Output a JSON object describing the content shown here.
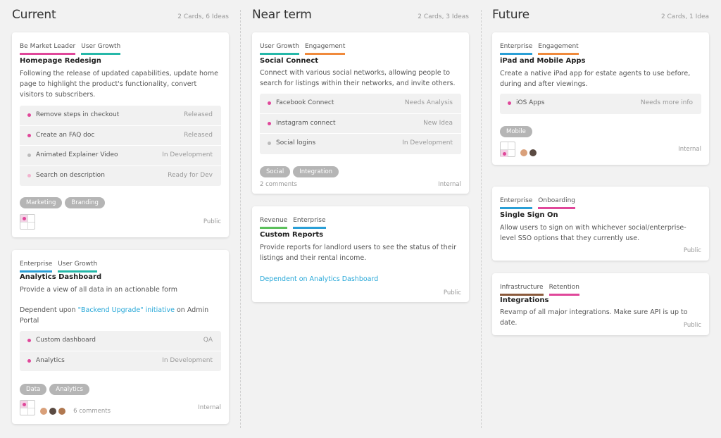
{
  "columns": [
    {
      "title": "Current",
      "count": "2 Cards, 6 Ideas",
      "cards": [
        {
          "tags": [
            {
              "label": "Be Market Leader",
              "color": "#e0479a"
            },
            {
              "label": "User Growth",
              "color": "#26b8a9"
            }
          ],
          "title": "Homepage Redesign",
          "desc": "Following the release of updated capabilities, update home page to highlight the product's functionality, convert visitors to subscribers.",
          "ideas": [
            {
              "name": "Remove steps in checkout",
              "status": "Released",
              "dot": "#e0479a"
            },
            {
              "name": "Create an FAQ doc",
              "status": "Released",
              "dot": "#e0479a"
            },
            {
              "name": "Animated Explainer Video",
              "status": "In Development",
              "dot": "#bbbbbb"
            },
            {
              "name": "Search on description",
              "status": "Ready for Dev",
              "dot": "#f2b4cf"
            }
          ],
          "chips": [
            "Marketing",
            "Branding"
          ],
          "visibility": "Public"
        },
        {
          "tags": [
            {
              "label": "Enterprise",
              "color": "#2a9fd6"
            },
            {
              "label": "User Growth",
              "color": "#26b8a9"
            }
          ],
          "title": "Analytics Dashboard",
          "desc": "Provide a view of all data in an actionable form",
          "dep_prefix": "Dependent upon ",
          "dep_link": "\"Backend Upgrade\" initiative",
          "dep_suffix": " on Admin Portal",
          "ideas": [
            {
              "name": "Custom dashboard",
              "status": "QA",
              "dot": "#e0479a"
            },
            {
              "name": "Analytics",
              "status": "In Development",
              "dot": "#e0479a"
            }
          ],
          "chips": [
            "Data",
            "Analytics"
          ],
          "comments": "6 comments",
          "visibility": "Internal"
        }
      ]
    },
    {
      "title": "Near term",
      "count": "2 Cards, 3 Ideas",
      "cards": [
        {
          "tags": [
            {
              "label": "User Growth",
              "color": "#26b8a9"
            },
            {
              "label": "Engagement",
              "color": "#f08a3c"
            }
          ],
          "title": "Social Connect",
          "desc": "Connect with various social networks, allowing people to search for listings within their networks, and invite others.",
          "ideas": [
            {
              "name": "Facebook Connect",
              "status": "Needs Analysis",
              "dot": "#e0479a"
            },
            {
              "name": "Instagram connect",
              "status": "New Idea",
              "dot": "#e0479a"
            },
            {
              "name": "Social logins",
              "status": "In Development",
              "dot": "#bbbbbb"
            }
          ],
          "chips": [
            "Social",
            "Integration"
          ],
          "comments": "2 comments",
          "visibility": "Internal"
        },
        {
          "tags": [
            {
              "label": "Revenue",
              "color": "#5cc05c"
            },
            {
              "label": "Enterprise",
              "color": "#2a9fd6"
            }
          ],
          "title": "Custom Reports",
          "desc": "Provide reports for landlord users to see the status of their listings and their rental income.",
          "dep_link": "Dependent on Analytics Dashboard",
          "visibility": "Public"
        }
      ]
    },
    {
      "title": "Future",
      "count": "2 Cards, 1 Idea",
      "cards": [
        {
          "tags": [
            {
              "label": "Enterprise",
              "color": "#2a9fd6"
            },
            {
              "label": "Engagement",
              "color": "#f08a3c"
            }
          ],
          "title": "iPad and Mobile Apps",
          "desc": "Create a native iPad app for estate agents to use before, during and after viewings.",
          "ideas": [
            {
              "name": "iOS Apps",
              "status": "Needs more info",
              "dot": "#e0479a"
            }
          ],
          "chips": [
            "Mobile"
          ],
          "visibility": "Internal"
        },
        {
          "tags": [
            {
              "label": "Enterprise",
              "color": "#2a9fd6"
            },
            {
              "label": "Onboarding",
              "color": "#e0479a"
            }
          ],
          "title": "Single Sign On",
          "desc": "Allow users to sign on with whichever social/enterprise-level SSO options that they currently use.",
          "visibility": "Public"
        },
        {
          "tags": [
            {
              "label": "Infrastructure",
              "color": "#8b5a3c"
            },
            {
              "label": "Retention",
              "color": "#e0479a"
            }
          ],
          "title": "Integrations",
          "desc": "Revamp of all major integrations. Make sure API is up to date.",
          "visibility": "Public"
        }
      ]
    }
  ]
}
